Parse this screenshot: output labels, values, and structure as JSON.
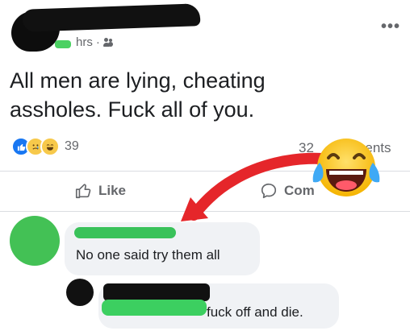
{
  "post": {
    "time": "hrs",
    "separator": "·",
    "text": "All men are lying, cheating assholes. Fuck all of you.",
    "reaction_count": "39",
    "comments_count": "32 comments",
    "comments_count_visible": "32",
    "comments_count_tail": "ents",
    "more_icon": "more-horizontal-icon"
  },
  "actions": {
    "like_label": "Like",
    "comment_label": "Comment",
    "comment_label_visible": "Com"
  },
  "comments": [
    {
      "text": "No one said try them all"
    },
    {
      "text": "fuck off and die."
    }
  ],
  "colors": {
    "arrow": "#e5262a",
    "redaction_green": "#3ccf60",
    "redaction_black": "#111111",
    "like_blue": "#1877f2",
    "bubble": "#f0f2f5"
  }
}
